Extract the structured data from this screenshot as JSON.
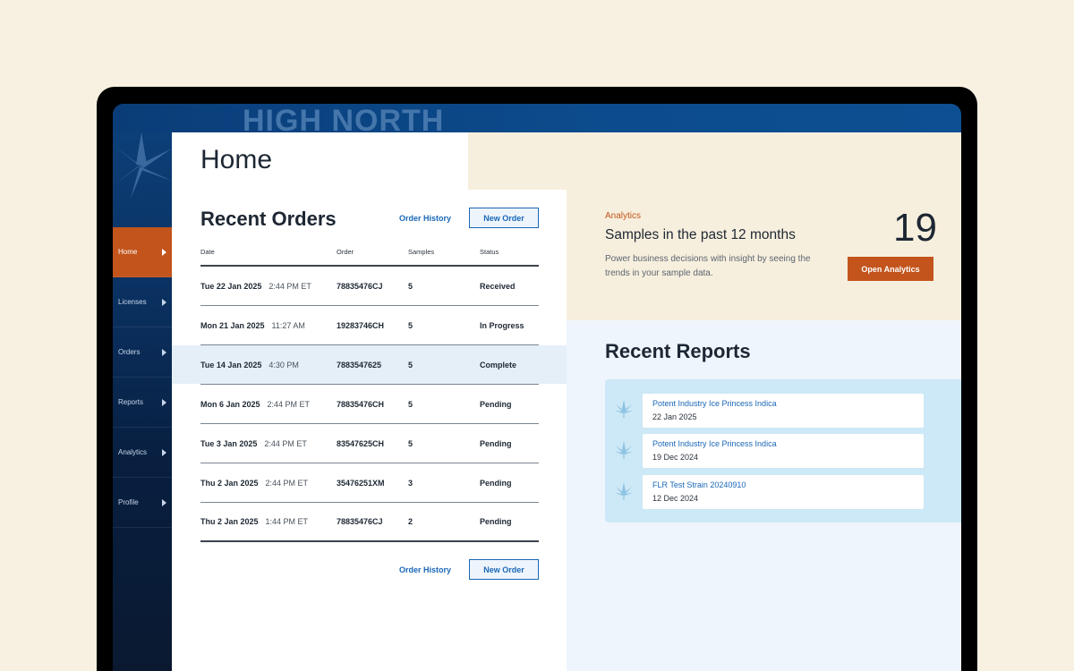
{
  "brand": {
    "name": "HIGH NORTH"
  },
  "colors": {
    "accent": "#c2541c",
    "link": "#1967b8",
    "navy": "#0a3d78",
    "highlight_row": "#e4eff8"
  },
  "sidebar": {
    "items": [
      {
        "label": "Home",
        "active": true
      },
      {
        "label": "Licenses",
        "active": false
      },
      {
        "label": "Orders",
        "active": false
      },
      {
        "label": "Reports",
        "active": false
      },
      {
        "label": "Analytics",
        "active": false
      },
      {
        "label": "Profile",
        "active": false
      }
    ]
  },
  "page": {
    "title": "Home"
  },
  "recent_orders": {
    "title": "Recent Orders",
    "order_history_label": "Order History",
    "new_order_label": "New Order",
    "columns": [
      "Date",
      "Order",
      "Samples",
      "Status"
    ],
    "rows": [
      {
        "day": "Tue 22 Jan 2025",
        "time": "2:44 PM ET",
        "order": "78835476CJ",
        "samples": "5",
        "status": "Received"
      },
      {
        "day": "Mon 21 Jan 2025",
        "time": "11:27 AM",
        "order": "19283746CH",
        "samples": "5",
        "status": "In Progress"
      },
      {
        "day": "Tue 14 Jan 2025",
        "time": "4:30 PM",
        "order": "7883547625",
        "samples": "5",
        "status": "Complete"
      },
      {
        "day": "Mon 6 Jan 2025",
        "time": "2:44 PM ET",
        "order": "78835476CH",
        "samples": "5",
        "status": "Pending"
      },
      {
        "day": "Tue 3 Jan 2025",
        "time": "2:44 PM ET",
        "order": "83547625CH",
        "samples": "5",
        "status": "Pending"
      },
      {
        "day": "Thu 2 Jan 2025",
        "time": "2:44 PM ET",
        "order": "35476251XM",
        "samples": "3",
        "status": "Pending"
      },
      {
        "day": "Thu 2 Jan 2025",
        "time": "1:44 PM ET",
        "order": "78835476CJ",
        "samples": "2",
        "status": "Pending"
      }
    ],
    "footer_order_history_label": "Order History",
    "footer_new_order_label": "New Order"
  },
  "analytics": {
    "kicker": "Analytics",
    "title": "Samples in the past 12 months",
    "description": "Power business decisions with insight by seeing the trends in your sample data.",
    "count": "19",
    "button_label": "Open Analytics"
  },
  "recent_reports": {
    "title": "Recent Reports",
    "items": [
      {
        "name": "Potent Industry Ice Princess Indica",
        "date": "22 Jan 2025",
        "icon": "cannabis-leaf-icon"
      },
      {
        "name": "Potent Industry Ice Princess Indica",
        "date": "19 Dec 2024",
        "icon": "cannabis-leaf-icon"
      },
      {
        "name": "FLR Test Strain 20240910",
        "date": "12 Dec 2024",
        "icon": "cannabis-leaf-icon"
      }
    ]
  }
}
